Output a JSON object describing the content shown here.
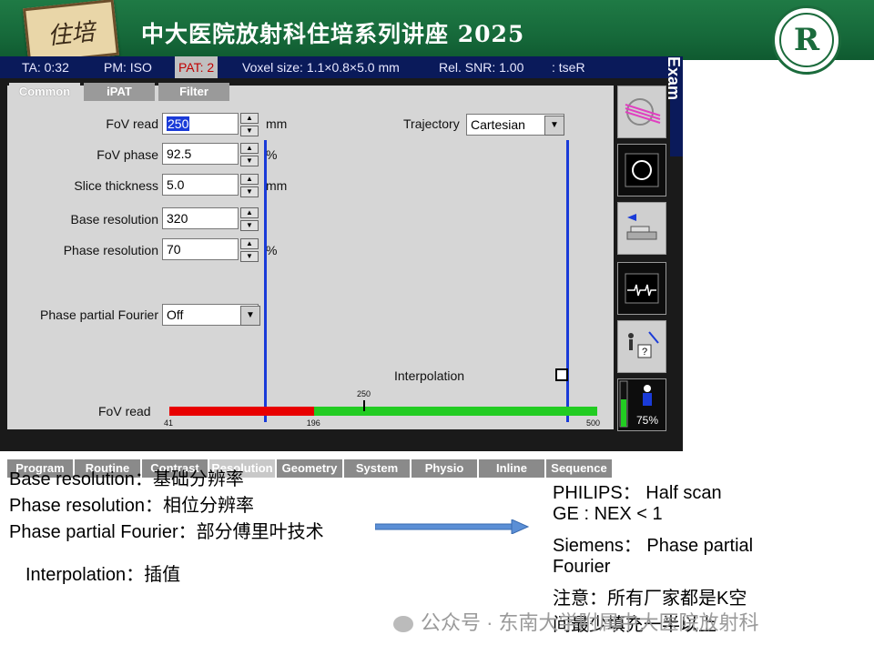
{
  "banner": {
    "badge_text": "住培",
    "title": "中大医院放射科住培系列讲座 2025",
    "logo_letter": "R"
  },
  "status": {
    "ta": "TA: 0:32",
    "pm": "PM: ISO",
    "pat": "PAT: 2",
    "voxel": "Voxel size: 1.1×0.8×5.0 mm",
    "snr": "Rel. SNR: 1.00",
    "seq": ": tseR",
    "exam": "Exam"
  },
  "tabs": [
    "Common",
    "iPAT",
    "Filter"
  ],
  "params": {
    "fov_read": {
      "label": "FoV read",
      "value": "250",
      "unit": "mm"
    },
    "fov_phase": {
      "label": "FoV phase",
      "value": "92.5",
      "unit": "%"
    },
    "slice_thickness": {
      "label": "Slice thickness",
      "value": "5.0",
      "unit": "mm"
    },
    "base_resolution": {
      "label": "Base resolution",
      "value": "320"
    },
    "phase_resolution": {
      "label": "Phase resolution",
      "value": "70",
      "unit": "%"
    },
    "phase_partial_fourier": {
      "label": "Phase partial Fourier",
      "value": "Off"
    },
    "trajectory": {
      "label": "Trajectory",
      "value": "Cartesian"
    },
    "interpolation": {
      "label": "Interpolation"
    }
  },
  "slider": {
    "label": "FoV read",
    "min": "41",
    "red_end": "196",
    "current": "250",
    "max": "500",
    "min_val": 41,
    "red_end_val": 196,
    "current_val": 250,
    "max_val": 500
  },
  "bottom_tabs": [
    "Program",
    "Routine",
    "Contrast",
    "Resolution",
    "Geometry",
    "System",
    "Physio",
    "Inline",
    "Sequence"
  ],
  "side_panel": {
    "percent": "75%"
  },
  "notes_left": [
    "Base resolution：基础分辨率",
    "Phase resolution：相位分辨率",
    "Phase partial Fourier：部分傅里叶技术",
    "Interpolation：插值"
  ],
  "notes_right": [
    "PHILIPS：  Half scan",
    "GE : NEX < 1",
    "Siemens：   Phase partial",
    "Fourier",
    "注意：所有厂家都是K空",
    "间最少填充一半以上"
  ],
  "watermark": "公众号 · 东南大学附属中大医院放射科"
}
